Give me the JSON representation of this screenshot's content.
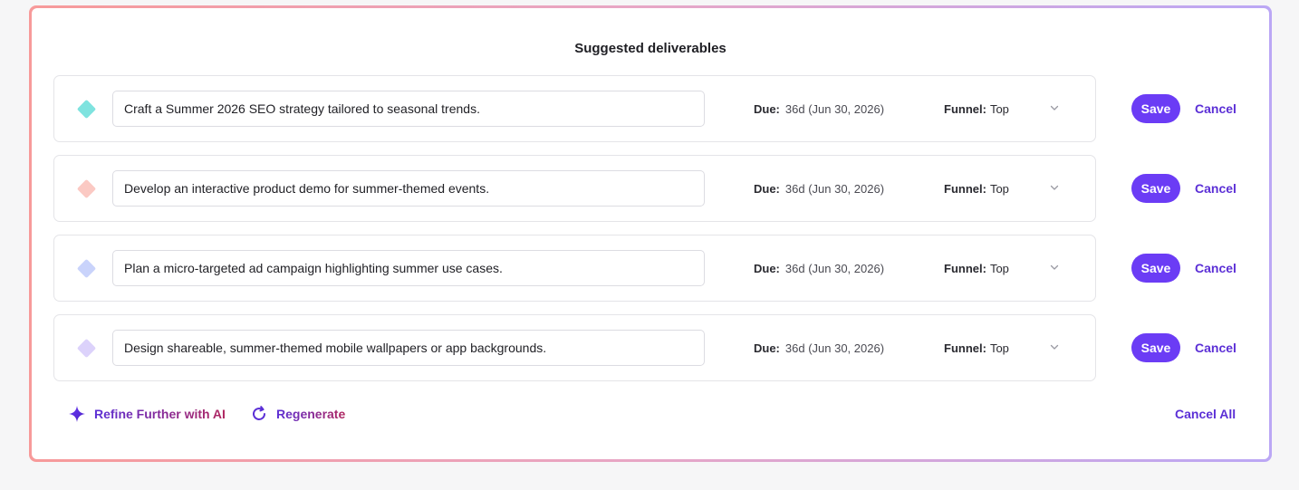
{
  "title": "Suggested deliverables",
  "colors": {
    "accent": "#6b3cf5",
    "diamonds": [
      "#7fe3df",
      "#fbc9c3",
      "#c9d3fb",
      "#dcd2fb"
    ]
  },
  "deliverables": [
    {
      "text": "Craft a Summer 2026 SEO strategy tailored to seasonal trends.",
      "due_label": "Due:",
      "due_value": "36d (Jun 30, 2026)",
      "funnel_label": "Funnel:",
      "funnel_value": "Top",
      "save_label": "Save",
      "cancel_label": "Cancel"
    },
    {
      "text": "Develop an interactive product demo for summer-themed events.",
      "due_label": "Due:",
      "due_value": "36d (Jun 30, 2026)",
      "funnel_label": "Funnel:",
      "funnel_value": "Top",
      "save_label": "Save",
      "cancel_label": "Cancel"
    },
    {
      "text": "Plan a micro-targeted ad campaign highlighting summer use cases.",
      "due_label": "Due:",
      "due_value": "36d (Jun 30, 2026)",
      "funnel_label": "Funnel:",
      "funnel_value": "Top",
      "save_label": "Save",
      "cancel_label": "Cancel"
    },
    {
      "text": "Design shareable, summer-themed mobile wallpapers or app backgrounds.",
      "due_label": "Due:",
      "due_value": "36d (Jun 30, 2026)",
      "funnel_label": "Funnel:",
      "funnel_value": "Top",
      "save_label": "Save",
      "cancel_label": "Cancel"
    }
  ],
  "footer": {
    "refine_label": "Refine Further with AI",
    "regenerate_label": "Regenerate",
    "cancel_all_label": "Cancel All"
  }
}
